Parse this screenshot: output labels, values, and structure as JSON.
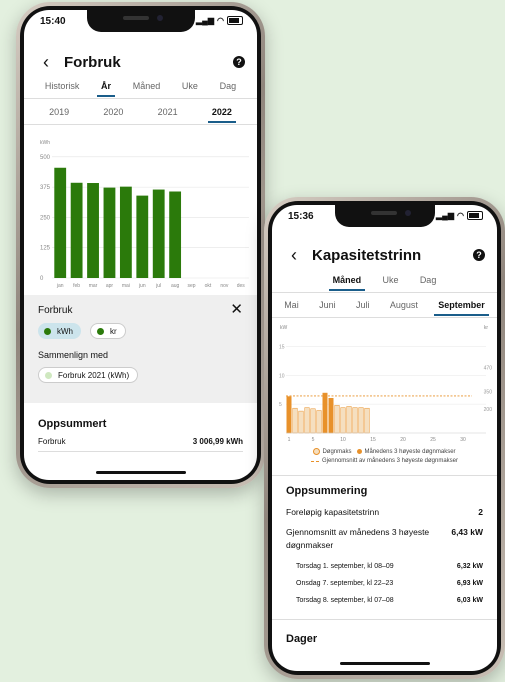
{
  "colors": {
    "background": "#e3f0df",
    "bar_green": "#2b7a0b",
    "bar_orange": "#e8912a",
    "bar_light_orange": "#f5dfc0",
    "accent_blue": "#1a5d8a"
  },
  "phone1": {
    "status_time": "15:40",
    "title": "Forbruk",
    "tabs": [
      "Historisk",
      "År",
      "Måned",
      "Uke",
      "Dag"
    ],
    "active_tab": "År",
    "years": [
      "2019",
      "2020",
      "2021",
      "2022"
    ],
    "active_year": "2022",
    "chart_unit": "kWh",
    "filter": {
      "title": "Forbruk",
      "options": [
        {
          "label": "kWh",
          "selected": true
        },
        {
          "label": "kr",
          "selected": false
        }
      ],
      "compare_title": "Sammenlign med",
      "compare_option": "Forbruk 2021 (kWh)"
    },
    "summary": {
      "title": "Oppsummert",
      "row_label": "Forbruk",
      "row_value": "3 006,99 kWh"
    }
  },
  "phone2": {
    "status_time": "15:36",
    "title": "Kapasitetstrinn",
    "tabs": [
      "Måned",
      "Uke",
      "Dag"
    ],
    "active_tab": "Måned",
    "months": [
      "Mai",
      "Juni",
      "Juli",
      "August",
      "September"
    ],
    "active_month": "September",
    "chart_left_unit": "kW",
    "chart_right_unit": "kr",
    "legend": [
      {
        "label": "Døgnmaks",
        "color": "#f5dfc0"
      },
      {
        "label": "Månedens 3 høyeste døgnmakser",
        "color": "#e8912a"
      },
      {
        "label": "Gjennomsnitt av månedens 3 høyeste døgnmakser",
        "color": "#e8912a"
      }
    ],
    "summary": {
      "title": "Oppsummering",
      "level_label": "Foreløpig kapasitetstrinn",
      "level_value": "2",
      "avg_label_1": "Gjennomsnitt av månedens 3 høyeste",
      "avg_label_2": "døgnmakser",
      "avg_value": "6,43 kW",
      "peaks": [
        {
          "label": "Torsdag 1. september, kl 08–09",
          "value": "6,32 kW"
        },
        {
          "label": "Onsdag 7. september, kl 22–23",
          "value": "6,93 kW"
        },
        {
          "label": "Torsdag 8. september, kl 07–08",
          "value": "6,03 kW"
        }
      ],
      "days_title": "Dager"
    }
  },
  "chart_data": [
    {
      "type": "bar",
      "categories": [
        "jan",
        "feb",
        "mar",
        "apr",
        "mai",
        "jun",
        "jul",
        "aug",
        "sep",
        "okt",
        "nov",
        "des"
      ],
      "values": [
        455,
        393,
        392,
        373,
        377,
        340,
        365,
        357,
        null,
        null,
        null,
        null
      ],
      "ylabel": "kWh",
      "yticks": [
        0,
        125,
        250,
        375,
        500
      ],
      "ylim": [
        0,
        520
      ],
      "grid": true
    },
    {
      "type": "bar",
      "x": [
        1,
        2,
        3,
        4,
        5,
        6,
        7,
        8,
        9,
        10,
        11,
        12,
        13,
        14
      ],
      "series": [
        {
          "name": "Døgnmaks",
          "values": [
            6.32,
            4.3,
            3.8,
            4.4,
            4.2,
            3.9,
            6.93,
            6.03,
            4.8,
            4.4,
            4.6,
            4.4,
            4.4,
            4.3
          ]
        }
      ],
      "top3_days": [
        1,
        7,
        8
      ],
      "average_line": 6.43,
      "xticks": [
        1,
        5,
        10,
        15,
        20,
        25,
        30
      ],
      "yticks_left": [
        5,
        10,
        15
      ],
      "yticks_right": [
        200,
        350,
        470
      ],
      "ylim": [
        0,
        17
      ],
      "grid": true
    }
  ]
}
